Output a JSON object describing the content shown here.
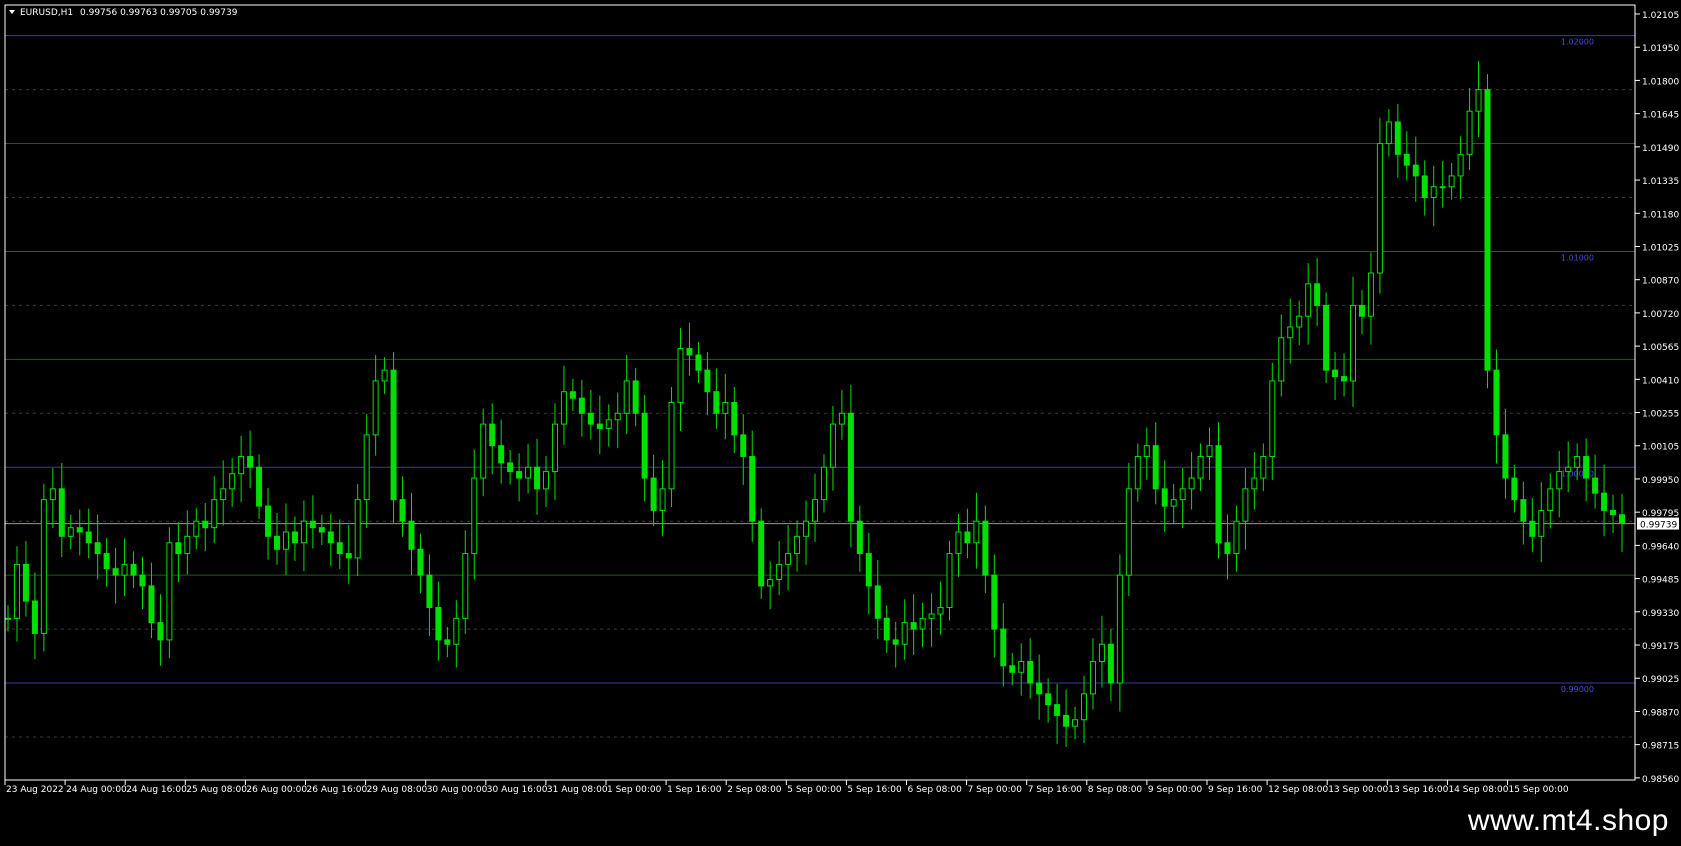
{
  "header": {
    "symbol": "EURUSD,H1",
    "ohlc": "0.99756 0.99763 0.99705 0.99739"
  },
  "price_axis": {
    "ticks": [
      "1.02105",
      "1.01950",
      "1.01800",
      "1.01645",
      "1.01490",
      "1.01335",
      "1.01180",
      "1.01025",
      "1.00870",
      "1.00720",
      "1.00565",
      "1.00410",
      "1.00255",
      "1.00105",
      "0.99950",
      "0.99795",
      "0.99640",
      "0.99485",
      "0.99330",
      "0.99175",
      "0.99025",
      "0.98870",
      "0.98715",
      "0.98560"
    ],
    "current_price": "0.99739"
  },
  "levels": [
    {
      "label": "1.02000",
      "price": 1.02
    },
    {
      "label": "1.01000",
      "price": 1.01
    },
    {
      "label": "1.00000",
      "price": 1.0
    },
    {
      "label": "0.99000",
      "price": 0.99
    }
  ],
  "green_levels": [
    1.015,
    1.005,
    0.995
  ],
  "time_axis": [
    "23 Aug 2022",
    "24 Aug 00:00",
    "24 Aug 16:00",
    "25 Aug 08:00",
    "26 Aug 00:00",
    "26 Aug 16:00",
    "29 Aug 08:00",
    "30 Aug 00:00",
    "30 Aug 16:00",
    "31 Aug 08:00",
    "1 Sep 00:00",
    "1 Sep 16:00",
    "2 Sep 08:00",
    "5 Sep 00:00",
    "5 Sep 16:00",
    "6 Sep 08:00",
    "7 Sep 00:00",
    "7 Sep 16:00",
    "8 Sep 08:00",
    "9 Sep 00:00",
    "9 Sep 16:00",
    "12 Sep 08:00",
    "13 Sep 00:00",
    "13 Sep 16:00",
    "14 Sep 08:00",
    "15 Sep 00:00"
  ],
  "watermark": "www.mt4.shop",
  "colors": {
    "background": "#000000",
    "candle": "#00e000",
    "level_line": "#3a3aa8",
    "level_label": "#4a4ae0",
    "green_grid": "#1f5a1f",
    "dashed_grid": "#3a3a3a",
    "axis_text": "#ffffff",
    "current_line": "#9a9a9a"
  },
  "chart_data": {
    "type": "line",
    "series": [
      {
        "name": "EURUSD,H1",
        "values": [
          0.993,
          0.9955,
          0.9938,
          0.9923,
          0.9985,
          0.999,
          0.9968,
          0.9972,
          0.997,
          0.9965,
          0.996,
          0.9953,
          0.995,
          0.9955,
          0.995,
          0.9945,
          0.9928,
          0.992,
          0.9965,
          0.996,
          0.9968,
          0.9975,
          0.9972,
          0.9985,
          0.999,
          0.9997,
          1.0005,
          1.0,
          0.9982,
          0.9968,
          0.9962,
          0.997,
          0.9965,
          0.9975,
          0.9972,
          0.997,
          0.9965,
          0.996,
          0.9958,
          0.9985,
          1.0015,
          1.004,
          1.0045,
          0.9985,
          0.9975,
          0.9962,
          0.995,
          0.9935,
          0.992,
          0.9918,
          0.993,
          0.996,
          0.9995,
          1.002,
          1.001,
          1.0002,
          0.9998,
          0.9995,
          1.0,
          0.999,
          0.9998,
          1.002,
          1.0035,
          1.0032,
          1.0025,
          1.002,
          1.0018,
          1.0022,
          1.0025,
          1.004,
          1.0025,
          0.9995,
          0.998,
          0.999,
          1.003,
          1.0055,
          1.0052,
          1.0045,
          1.0035,
          1.0025,
          1.003,
          1.0015,
          1.0005,
          0.9975,
          0.9945,
          0.9948,
          0.9955,
          0.996,
          0.9968,
          0.9975,
          0.9985,
          1.0,
          1.002,
          1.0025,
          0.9975,
          0.996,
          0.9945,
          0.993,
          0.992,
          0.9918,
          0.9928,
          0.9925,
          0.993,
          0.9932,
          0.9935,
          0.996,
          0.997,
          0.9965,
          0.9975,
          0.995,
          0.9925,
          0.9908,
          0.9905,
          0.991,
          0.99,
          0.9895,
          0.989,
          0.9885,
          0.988,
          0.9883,
          0.9895,
          0.991,
          0.9918,
          0.99,
          0.995,
          0.999,
          1.0005,
          1.001,
          0.999,
          0.9982,
          0.9985,
          0.999,
          0.9995,
          1.0005,
          1.001,
          0.9965,
          0.996,
          0.9975,
          0.999,
          0.9995,
          1.0005,
          1.004,
          1.006,
          1.0065,
          1.007,
          1.0085,
          1.0075,
          1.0045,
          1.0042,
          1.004,
          1.0075,
          1.007,
          1.009,
          1.015,
          1.016,
          1.0145,
          1.014,
          1.0135,
          1.0125,
          1.013,
          1.013,
          1.0135,
          1.0145,
          1.0165,
          1.0175,
          1.0045,
          1.0015,
          0.9995,
          0.9985,
          0.9975,
          0.9968,
          0.998,
          0.999,
          0.9998,
          1.0,
          1.0005,
          0.9995,
          0.9988,
          0.998,
          0.9978,
          0.9974
        ]
      }
    ],
    "ylim": [
      0.9856,
      1.02105
    ],
    "ylabel": "",
    "xlabel": "",
    "grid": true
  }
}
